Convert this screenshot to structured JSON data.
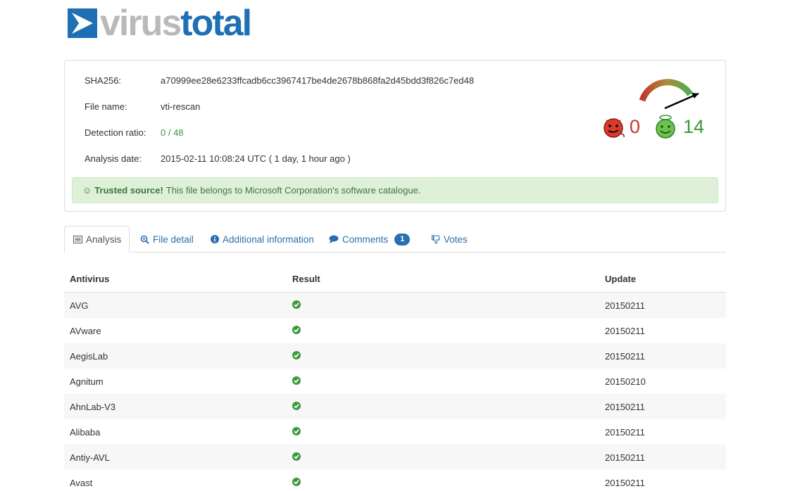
{
  "brand": {
    "name_part1": "virus",
    "name_part2": "total",
    "color_gray": "#b9b9b9",
    "color_blue": "#1e6fb3"
  },
  "file_info": {
    "sha_label": "SHA256:",
    "sha_value": "a70999ee28e6233ffcadb6cc3967417be4de2678b868fa2d45bdd3f826c7ed48",
    "name_label": "File name:",
    "name_value": "vti-rescan",
    "ratio_label": "Detection ratio:",
    "ratio_value": "0 / 48",
    "date_label": "Analysis date:",
    "date_value": "2015-02-11 10:08:24 UTC ( 1 day, 1 hour ago )"
  },
  "trusted": {
    "icon": "smile-icon",
    "strong": "Trusted source!",
    "text": "This file belongs to Microsoft Corporation's software catalogue."
  },
  "community": {
    "malicious_votes": "0",
    "harmless_votes": "14",
    "gauge_level_fraction": 0.9
  },
  "tabs": [
    {
      "label": "Analysis",
      "icon": "list-icon",
      "active": true
    },
    {
      "label": "File detail",
      "icon": "zoom-icon",
      "active": false
    },
    {
      "label": "Additional information",
      "icon": "info-icon",
      "active": false
    },
    {
      "label": "Comments",
      "icon": "comment-icon",
      "active": false,
      "badge": "1"
    },
    {
      "label": "Votes",
      "icon": "thumbs-down-icon",
      "active": false
    }
  ],
  "table": {
    "headers": [
      "Antivirus",
      "Result",
      "Update"
    ],
    "rows": [
      {
        "antivirus": "AVG",
        "update": "20150211"
      },
      {
        "antivirus": "AVware",
        "update": "20150211"
      },
      {
        "antivirus": "AegisLab",
        "update": "20150211"
      },
      {
        "antivirus": "Agnitum",
        "update": "20150210"
      },
      {
        "antivirus": "AhnLab-V3",
        "update": "20150211"
      },
      {
        "antivirus": "Alibaba",
        "update": "20150211"
      },
      {
        "antivirus": "Antiy-AVL",
        "update": "20150211"
      },
      {
        "antivirus": "Avast",
        "update": "20150211"
      }
    ]
  }
}
